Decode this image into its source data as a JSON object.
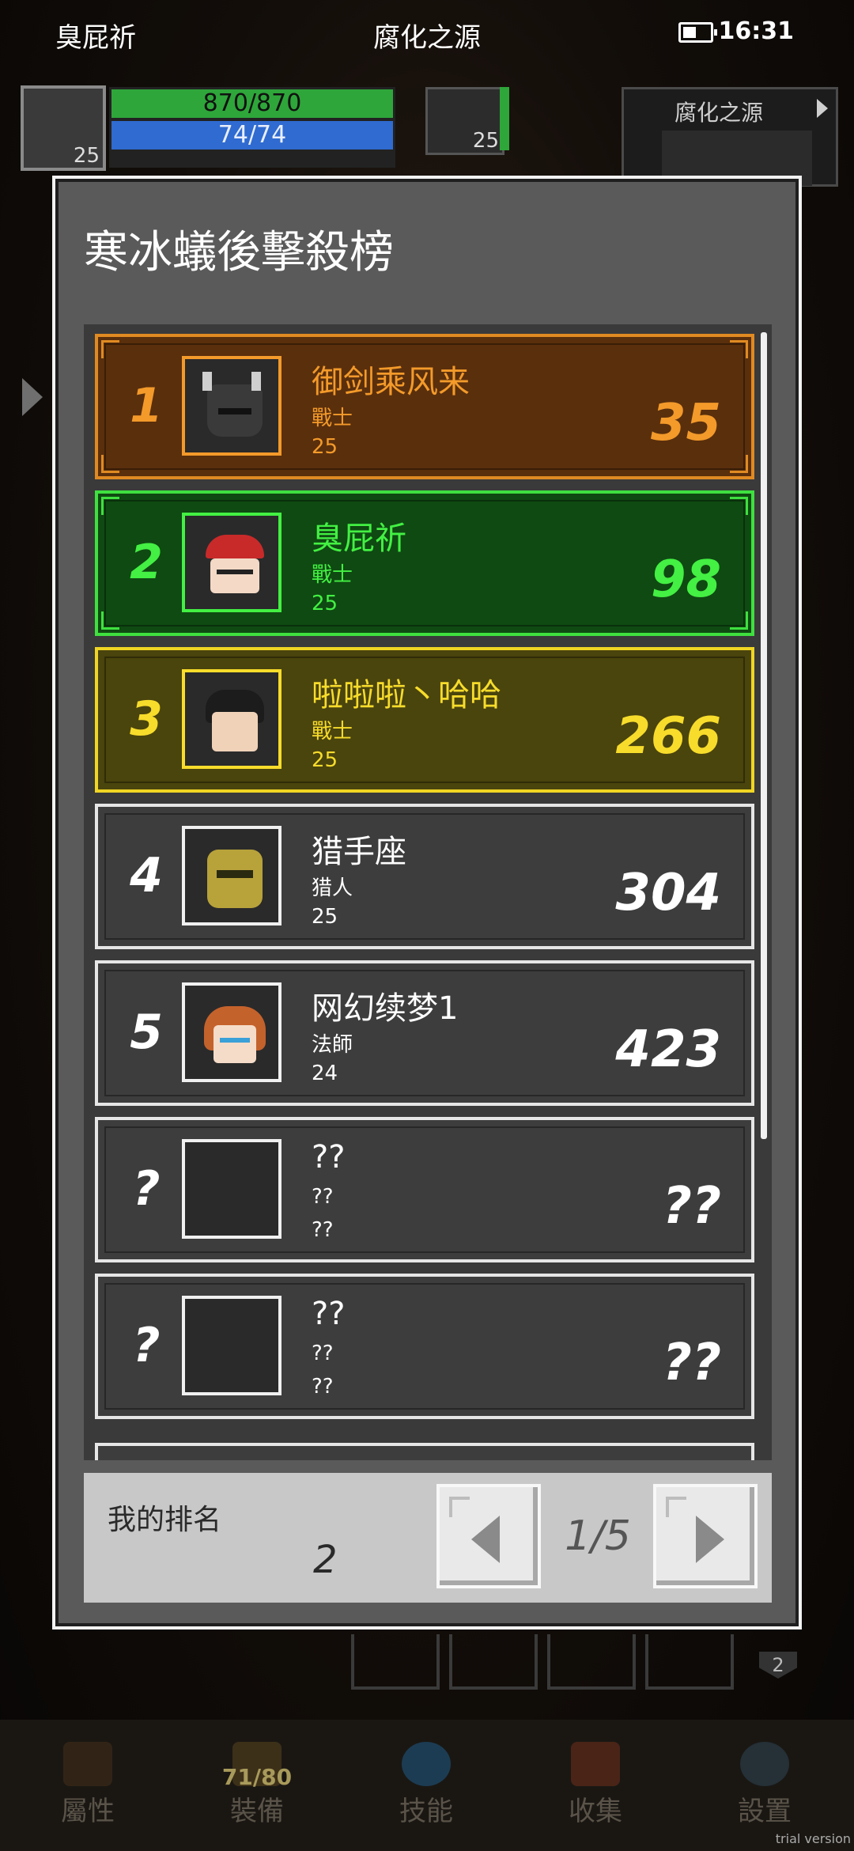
{
  "status_bar": {
    "left": "臭屁祈",
    "center": "腐化之源",
    "time": "16:31"
  },
  "hud": {
    "player_level": "25",
    "hp": "870/870",
    "mp": "74/74",
    "pet_level": "25",
    "minimap_title": "腐化之源"
  },
  "modal": {
    "title": "寒冰蟻後擊殺榜",
    "rows": [
      {
        "rank": "1",
        "name": "御剑乘风来",
        "class": "戰士",
        "level": "25",
        "score": "35"
      },
      {
        "rank": "2",
        "name": "臭屁祈",
        "class": "戰士",
        "level": "25",
        "score": "98"
      },
      {
        "rank": "3",
        "name": "啦啦啦丶哈哈",
        "class": "戰士",
        "level": "25",
        "score": "266"
      },
      {
        "rank": "4",
        "name": "猎手座",
        "class": "猎人",
        "level": "25",
        "score": "304"
      },
      {
        "rank": "5",
        "name": "网幻续梦1",
        "class": "法師",
        "level": "24",
        "score": "423"
      },
      {
        "rank": "?",
        "name": "??",
        "class": "??",
        "level": "??",
        "score": "??"
      },
      {
        "rank": "?",
        "name": "??",
        "class": "??",
        "level": "??",
        "score": "??"
      }
    ],
    "footer": {
      "my_rank_label": "我的排名",
      "my_rank": "2",
      "page": "1/5"
    }
  },
  "bottom": {
    "pet_count": "2"
  },
  "nav": [
    {
      "label": "屬性"
    },
    {
      "label": "裝備",
      "count": "71/80"
    },
    {
      "label": "技能"
    },
    {
      "label": "收集"
    },
    {
      "label": "設置"
    }
  ],
  "watermark": "trial version",
  "colors": {
    "gold": "#f39a2a",
    "green": "#43f043",
    "yellow": "#f7dc2b",
    "panel": "#5a5a5a"
  }
}
